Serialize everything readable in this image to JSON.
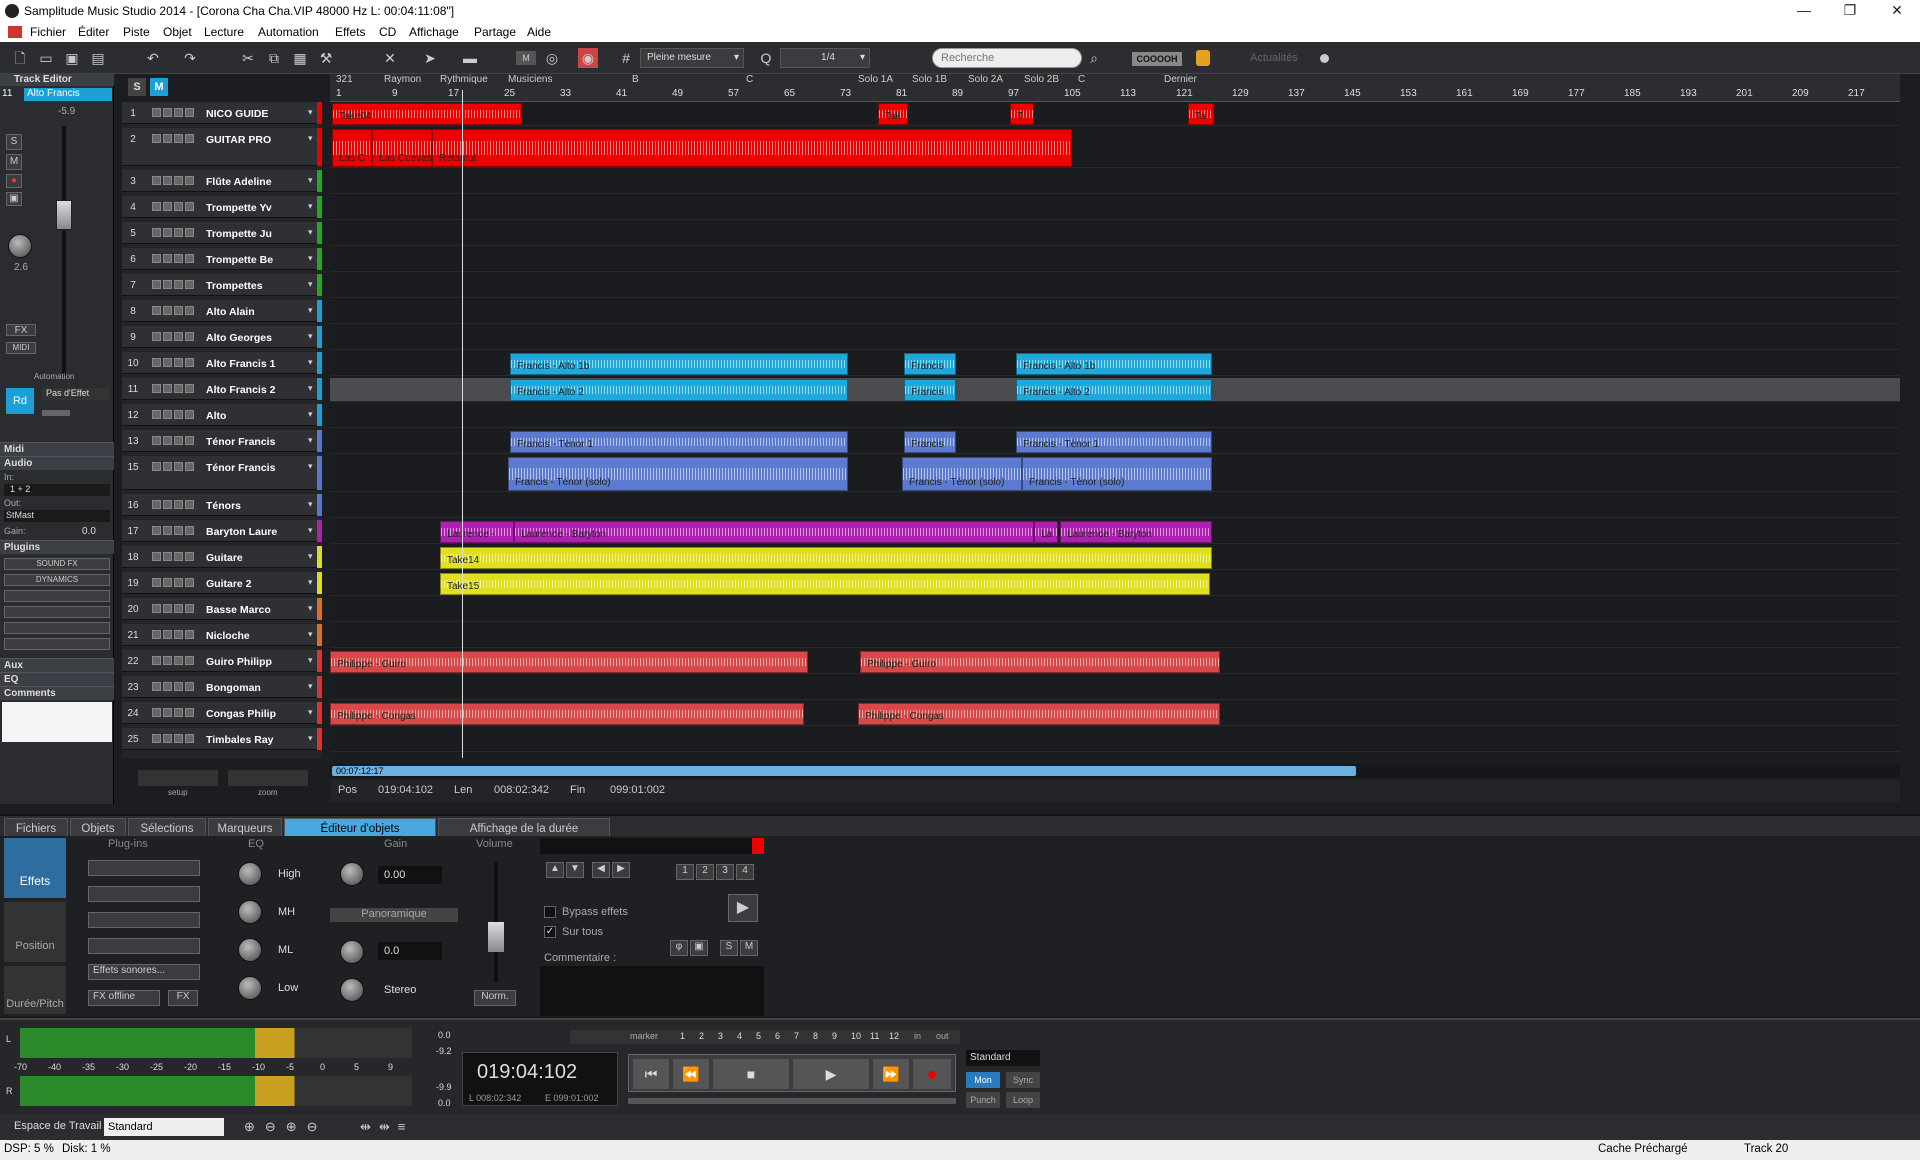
{
  "window": {
    "title": "Samplitude Music Studio 2014 - [Corona Cha Cha.VIP   48000 Hz L: 00:04:11:08\"]"
  },
  "menu": [
    "Fichier",
    "Éditer",
    "Piste",
    "Objet",
    "Lecture",
    "Automation",
    "Effets",
    "CD",
    "Affichage",
    "Partage",
    "Aide"
  ],
  "toolbar": {
    "snap_mode": "Pleine mesure",
    "grid": "1/4",
    "search_placeholder": "Recherche",
    "brand": "COOOOH",
    "news": "Actualités"
  },
  "track_editor": {
    "title": "Track Editor",
    "track_num": "11",
    "track_name": "Alto Francis",
    "level": "-5.9",
    "pan": "2.6",
    "automation": "Automation",
    "rd": "Rd",
    "fx_mode": "Pas d'Effet",
    "sections": {
      "midi": "Midi",
      "audio": "Audio",
      "plugins": "Plugins",
      "aux": "Aux",
      "eq": "EQ",
      "comments": "Comments"
    },
    "in_label": "In:",
    "in_value": "1 + 2",
    "out_label": "Out:",
    "out_value": "StMast",
    "gain_label": "Gain:",
    "gain_value": "0.0",
    "sound_fx": "SOUND FX",
    "dynamics": "DYNAMICS",
    "fx_btn": "FX",
    "midi_btn": "MIDI",
    "setup": "setup",
    "zoom": "zoom"
  },
  "ruler": {
    "markers": [
      "321",
      "Raymon",
      "Rythmique",
      "Musiciens",
      "B",
      "C",
      "Solo 1A",
      "Solo 1B",
      "Solo 2A",
      "Solo 2B",
      "C",
      "Dernier"
    ],
    "ticks": [
      "1",
      "9",
      "17",
      "25",
      "33",
      "41",
      "49",
      "57",
      "65",
      "73",
      "81",
      "89",
      "97",
      "105",
      "113",
      "121",
      "129",
      "137",
      "145",
      "153",
      "161",
      "169",
      "177",
      "185",
      "193",
      "201",
      "209",
      "217"
    ]
  },
  "tracks": [
    {
      "n": "1",
      "name": "NICO GUIDE",
      "color": "#e00"
    },
    {
      "n": "2",
      "name": "GUITAR PRO",
      "color": "#e00"
    },
    {
      "n": "3",
      "name": "Flûte Adeline",
      "color": "#2a2"
    },
    {
      "n": "4",
      "name": "Trompette Yv",
      "color": "#2a2"
    },
    {
      "n": "5",
      "name": "Trompette Ju",
      "color": "#2a2"
    },
    {
      "n": "6",
      "name": "Trompette Be",
      "color": "#2a2"
    },
    {
      "n": "7",
      "name": "Trompettes",
      "color": "#2a2"
    },
    {
      "n": "8",
      "name": "Alto Alain",
      "color": "#1a9fd6"
    },
    {
      "n": "9",
      "name": "Alto Georges",
      "color": "#1a9fd6"
    },
    {
      "n": "10",
      "name": "Alto Francis 1",
      "color": "#1a9fd6"
    },
    {
      "n": "11",
      "name": "Alto Francis 2",
      "color": "#1a9fd6"
    },
    {
      "n": "12",
      "name": "Alto",
      "color": "#1a9fd6"
    },
    {
      "n": "13",
      "name": "Ténor Francis",
      "color": "#5a78c8"
    },
    {
      "n": "15",
      "name": "Ténor Francis",
      "color": "#5a78c8"
    },
    {
      "n": "16",
      "name": "Ténors",
      "color": "#5a78c8"
    },
    {
      "n": "17",
      "name": "Baryton Laure",
      "color": "#b020b0"
    },
    {
      "n": "18",
      "name": "Guitare",
      "color": "#dddd20"
    },
    {
      "n": "19",
      "name": "Guitare 2",
      "color": "#dddd20"
    },
    {
      "n": "20",
      "name": "Basse Marco",
      "color": "#e07020"
    },
    {
      "n": "21",
      "name": "Nicloche",
      "color": "#e07020"
    },
    {
      "n": "22",
      "name": "Guiro Philipp",
      "color": "#e03030"
    },
    {
      "n": "23",
      "name": "Bongoman",
      "color": "#e03030"
    },
    {
      "n": "24",
      "name": "Congas Philip",
      "color": "#e03030"
    },
    {
      "n": "25",
      "name": "Timbales Ray",
      "color": "#e03030"
    }
  ],
  "clips": [
    {
      "label": "Take04",
      "color": "#e00"
    },
    {
      "label": "Tak",
      "color": "#e00"
    },
    {
      "label": "T",
      "color": "#e00"
    },
    {
      "label": "Ta",
      "color": "#e00"
    },
    {
      "label": "Las C",
      "color": "#e00"
    },
    {
      "label": "Las Cuevas",
      "color": "#e00"
    },
    {
      "label": "Retampl",
      "color": "#e00"
    },
    {
      "label": "Francis - Alto 1b",
      "color": "#1ea8dc"
    },
    {
      "label": "Francis",
      "color": "#1ea8dc"
    },
    {
      "label": "Francis - Alto 1b",
      "color": "#1ea8dc"
    },
    {
      "label": "Francis - Alto 2",
      "color": "#1ea8dc"
    },
    {
      "label": "Francis",
      "color": "#1ea8dc"
    },
    {
      "label": "Francis - Alto 2",
      "color": "#1ea8dc"
    },
    {
      "label": "Francis - Ténor 1",
      "color": "#5c7bd0"
    },
    {
      "label": "Francis",
      "color": "#5c7bd0"
    },
    {
      "label": "Francis - Ténor 1",
      "color": "#5c7bd0"
    },
    {
      "label": "Francis - Ténor (solo)",
      "color": "#5c7bd0"
    },
    {
      "label": "Francis - Ténor (solo)",
      "color": "#5c7bd0"
    },
    {
      "label": "Francis - Ténor (solo)",
      "color": "#5c7bd0"
    },
    {
      "label": "Laurence -",
      "color": "#b020b0"
    },
    {
      "label": "Laurence - Baryton",
      "color": "#b020b0"
    },
    {
      "label": "La",
      "color": "#b020b0"
    },
    {
      "label": "Laurence - Baryton",
      "color": "#b020b0"
    },
    {
      "label": "Take14",
      "color": "#e0e020"
    },
    {
      "label": "Take15",
      "color": "#e0e020"
    },
    {
      "label": "Philippe - Guiro",
      "color": "#d84848"
    },
    {
      "label": "Philippe - Guiro",
      "color": "#d84848"
    },
    {
      "label": "Philippe - Congas",
      "color": "#d84848"
    },
    {
      "label": "Philippe - Congas",
      "color": "#d84848"
    }
  ],
  "scroll_time": "00:07:12:17",
  "poslen": {
    "pos_label": "Pos",
    "pos": "019:04:102",
    "len_label": "Len",
    "len": "008:02:342",
    "fin_label": "Fin",
    "fin": "099:01:002"
  },
  "bottom_tabs": [
    "Fichiers",
    "Objets",
    "Sélections",
    "Marqueurs",
    "Éditeur d'objets",
    "Affichage de la durée"
  ],
  "obj_editor": {
    "effets": "Effets",
    "position": "Position",
    "duree": "Durée/Pitch",
    "plugins": "Plug-ins",
    "eq": "EQ",
    "gain": "Gain",
    "volume": "Volume",
    "high": "High",
    "mh": "MH",
    "ml": "ML",
    "low": "Low",
    "gain_val": "0.00",
    "panoramique": "Panoramique",
    "pan_val": "0.0",
    "stereo": "Stereo",
    "effets_sonores": "Effets sonores...",
    "fx_offline": "FX offline",
    "fx": "FX",
    "norm": "Norm.",
    "bypass": "Bypass effets",
    "sur_tous": "Sur tous",
    "commentaire": "Commentaire :",
    "pages": [
      "1",
      "2",
      "3",
      "4"
    ]
  },
  "transport": {
    "time": "019:04:102",
    "sub_l": "L 008:02:342",
    "sub_e": "E 099:01:002",
    "mode": "Standard",
    "mon": "Mon",
    "sync": "Sync",
    "punch": "Punch",
    "loop": "Loop",
    "marker": "marker",
    "in": "in",
    "out": "out",
    "marker_nums": [
      "1",
      "2",
      "3",
      "4",
      "5",
      "6",
      "7",
      "8",
      "9",
      "10",
      "11",
      "12"
    ],
    "scale": [
      "-70",
      "-40",
      "-35",
      "-30",
      "-25",
      "-20",
      "-15",
      "-10",
      "-5",
      "0",
      "5",
      "9"
    ],
    "peak_l": [
      "0.0",
      "-9.2"
    ],
    "peak_r": [
      "-9.9",
      "0.0"
    ],
    "l": "L",
    "r": "R"
  },
  "workspace": {
    "label": "Espace de Travail",
    "value": "Standard"
  },
  "status": {
    "dsp": "DSP: 5 %",
    "disk": "Disk:  1 %",
    "cache": "Cache Préchargé",
    "track": "Track 20"
  }
}
